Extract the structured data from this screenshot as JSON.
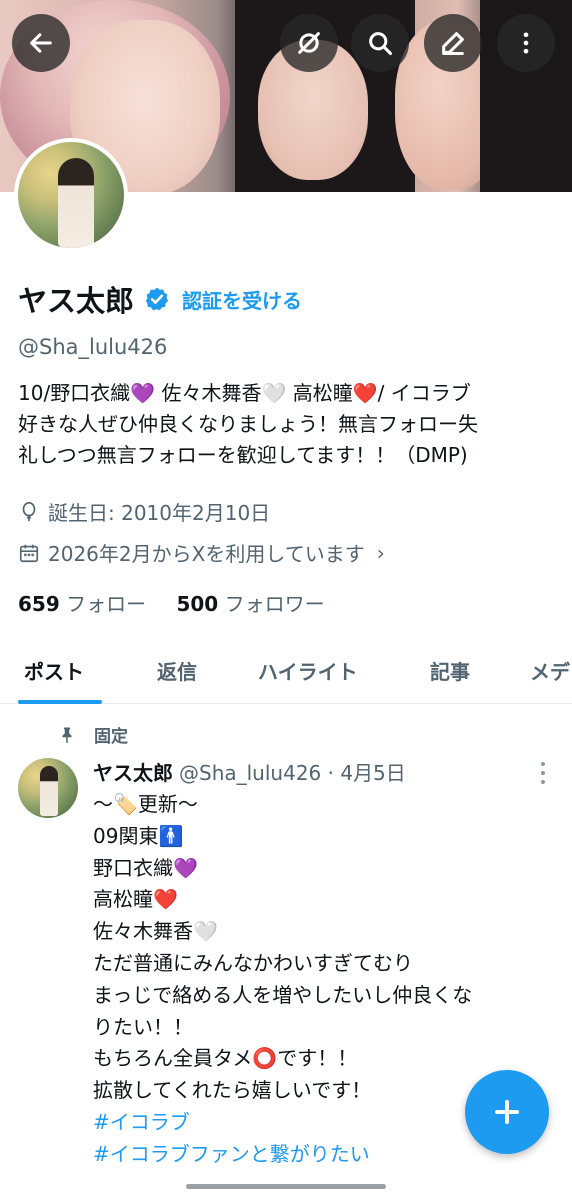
{
  "header": {
    "back_icon": "arrow-left-icon",
    "actions": [
      "grok-icon",
      "search-icon",
      "edit-icon",
      "more-vertical-icon"
    ]
  },
  "profile": {
    "name": "ヤス太郎",
    "verify_cta": "認証を受ける",
    "handle": "@Sha_lulu426",
    "bio_lines": [
      "10/野口衣織💜 佐々木舞香🤍 高松瞳❤️/ イコラブ",
      "好きな人ぜひ仲良くなりましょう！無言フォロー失",
      "礼しつつ無言フォローを歓迎してます！！（DMP)"
    ],
    "birthday": "誕生日: 2010年2月10日",
    "joined": "2026年2月からXを利用しています",
    "following_count": "659",
    "following_label": "フォロー",
    "followers_count": "500",
    "followers_label": "フォロワー"
  },
  "tabs": [
    {
      "label": "ポスト",
      "active": true
    },
    {
      "label": "返信",
      "active": false
    },
    {
      "label": "ハイライト",
      "active": false
    },
    {
      "label": "記事",
      "active": false
    },
    {
      "label": "メデ",
      "active": false
    }
  ],
  "pinned_post": {
    "pinned_label": "固定",
    "author": "ヤス太郎",
    "meta": "@Sha_lulu426 · 4月5日",
    "lines": [
      "〜🏷️更新〜",
      "09関東🚹",
      "野口衣織💜",
      "高松瞳❤️",
      "佐々木舞香🤍",
      "ただ普通にみんなかわいすぎてむり",
      "まっじで絡める人を増やしたいし仲良くな",
      "りたい！！",
      "もちろん全員タメ⭕です！！",
      "拡散してくれたら嬉しいです！"
    ],
    "hashtags": [
      "#イコラブ",
      "#イコラブファンと繋がりたい"
    ]
  },
  "colors": {
    "accent": "#1d9bf0",
    "text": "#0f1419",
    "muted": "#536471"
  }
}
